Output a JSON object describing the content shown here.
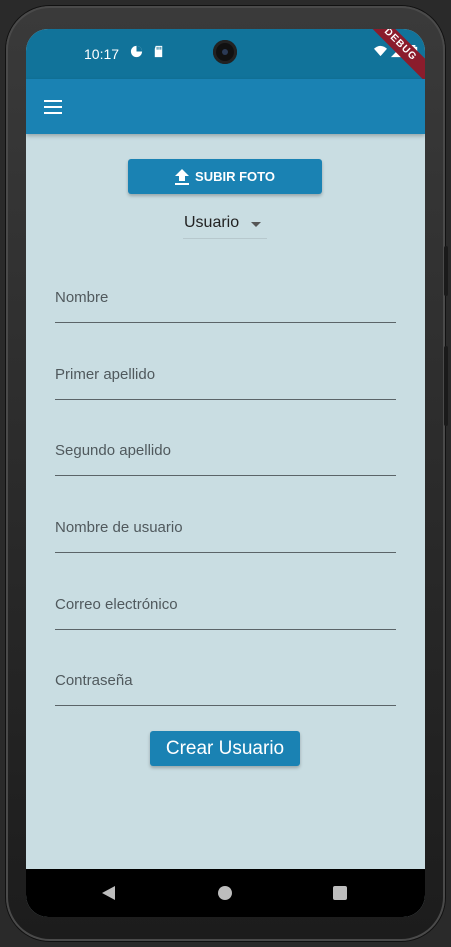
{
  "status_bar": {
    "time": "10:17",
    "debug_banner": "DEBUG"
  },
  "app_bar": {
    "menu_icon": "menu-icon"
  },
  "upload_button": {
    "label": "SUBIR FOTO",
    "icon": "upload-icon"
  },
  "role_dropdown": {
    "selected": "Usuario"
  },
  "fields": [
    {
      "name": "nombre-field",
      "placeholder": "Nombre",
      "value": ""
    },
    {
      "name": "primer-apellido-field",
      "placeholder": "Primer apellido",
      "value": ""
    },
    {
      "name": "segundo-apellido-field",
      "placeholder": "Segundo apellido",
      "value": ""
    },
    {
      "name": "nombre-usuario-field",
      "placeholder": "Nombre de usuario",
      "value": ""
    },
    {
      "name": "correo-field",
      "placeholder": "Correo electrónico",
      "value": ""
    },
    {
      "name": "contrasena-field",
      "placeholder": "Contraseña",
      "value": ""
    }
  ],
  "create_button": {
    "label": "Crear Usuario"
  },
  "colors": {
    "primary": "#1a82b3",
    "status_bar": "#11739a",
    "background": "#c9dde2"
  }
}
